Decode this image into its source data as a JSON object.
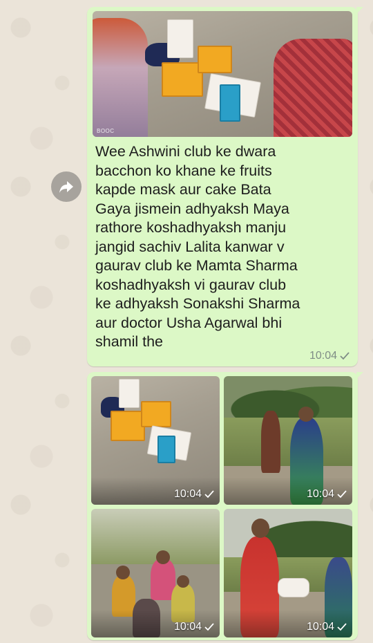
{
  "message_text": {
    "caption": "Wee Ashwini club ke dwara\nbacchon ko khane ke fruits\nkapde mask aur cake Bata\nGaya jismein adhyaksh Maya\nrathore koshadhyaksh manju\njangid sachiv Lalita kanwar v\ngaurav club ke Mamta Sharma\nkoshadhyaksh vi gaurav club\nke adhyaksh Sonakshi Sharma\naur doctor Usha Agarwal bhi\nshamil the",
    "time": "10:04",
    "photo_watermark": "BOOC"
  },
  "album": {
    "photos": [
      {
        "time": "10:04"
      },
      {
        "time": "10:04"
      },
      {
        "time": "10:04"
      },
      {
        "time": "10:04"
      }
    ]
  },
  "icons": {
    "forward": "forward-arrow-icon",
    "read_receipt": "single-check-icon"
  },
  "colors": {
    "bubble": "#dcf8c6",
    "wallpaper": "#ece5dd",
    "meta_text": "#7f8c86"
  }
}
